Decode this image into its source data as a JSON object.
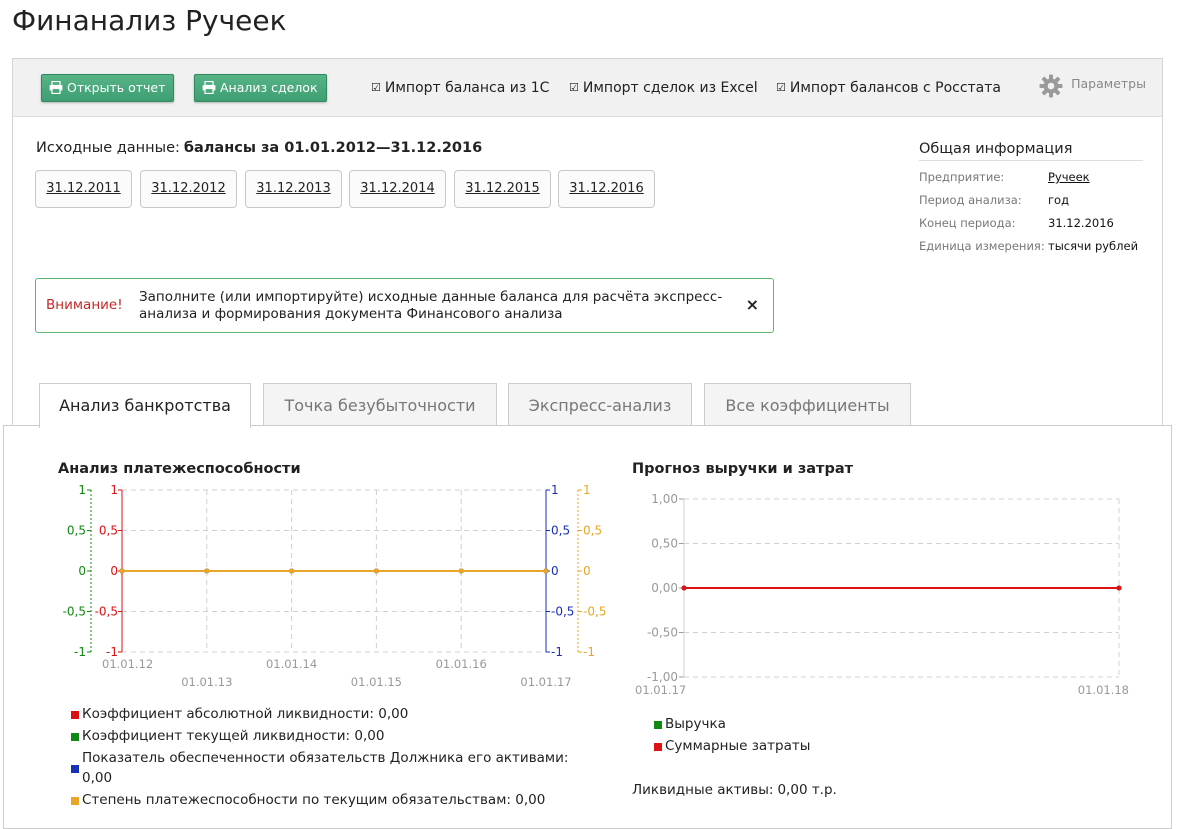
{
  "app": {
    "title": "Финанализ Ручеек"
  },
  "toolbar": {
    "open_report": "Открыть отчет",
    "deals_analysis": "Анализ сделок",
    "import_1c": "Импорт баланса из 1С",
    "import_excel": "Импорт сделок из Excel",
    "import_rosstat": "Импорт балансов с Росстата",
    "params": "Параметры"
  },
  "source": {
    "label": "Исходные данные:",
    "value": "балансы за 01.01.2012—31.12.2016"
  },
  "dates": [
    "31.12.2011",
    "31.12.2012",
    "31.12.2013",
    "31.12.2014",
    "31.12.2015",
    "31.12.2016"
  ],
  "info": {
    "title": "Общая информация",
    "rows": [
      {
        "key": "Предприятие:",
        "value": "Ручеек"
      },
      {
        "key": "Период анализа:",
        "value": "год"
      },
      {
        "key": "Конец периода:",
        "value": "31.12.2016"
      },
      {
        "key": "Единица измерения:",
        "value": "тысячи рублей"
      }
    ]
  },
  "alert": {
    "label": "Внимание!",
    "message": "Заполните (или импортируйте) исходные данные баланса для расчёта экспресс-анализа и формирования документа Финансового анализа",
    "close": "×"
  },
  "tabs": [
    "Анализ банкротства",
    "Точка безубыточности",
    "Экспресс-анализ",
    "Все коэффициенты"
  ],
  "colors": {
    "red": "#dd1111",
    "green": "#118811",
    "blue": "#1a2fb8",
    "orange": "#e8a628",
    "accent": "#4aa97a"
  },
  "chart_data": [
    {
      "type": "line",
      "title": "Анализ платежеспособности",
      "x": [
        "01.01.12",
        "01.01.13",
        "01.01.14",
        "01.01.15",
        "01.01.16",
        "01.01.17"
      ],
      "ylim": [
        -1,
        1
      ],
      "yticks": [
        "-1",
        "-0,5",
        "0",
        "0,5",
        "1"
      ],
      "grid": true,
      "series": [
        {
          "name": "Коэффициент абсолютной ликвидности: 0,00",
          "color": "#dd1111",
          "values": [
            0,
            0,
            0,
            0,
            0,
            0
          ]
        },
        {
          "name": "Коэффициент текущей ликвидности: 0,00",
          "color": "#118811",
          "values": [
            0,
            0,
            0,
            0,
            0,
            0
          ]
        },
        {
          "name": "Показатель обеспеченности обязательств Должника его активами: 0,00",
          "color": "#1a2fb8",
          "values": [
            0,
            0,
            0,
            0,
            0,
            0
          ]
        },
        {
          "name": "Степень платежеспособности по текущим обязательствам: 0,00",
          "color": "#e8a628",
          "values": [
            0,
            0,
            0,
            0,
            0,
            0
          ]
        }
      ]
    },
    {
      "type": "line",
      "title": "Прогноз выручки и затрат",
      "x": [
        "01.01.17",
        "01.01.18"
      ],
      "ylim": [
        -1,
        1
      ],
      "yticks": [
        "-1,00",
        "-0,50",
        "0,00",
        "0,50",
        "1,00"
      ],
      "grid": true,
      "series": [
        {
          "name": "Выручка",
          "color": "#118811",
          "values": [
            0,
            0
          ]
        },
        {
          "name": "Суммарные затраты",
          "color": "#dd1111",
          "values": [
            0,
            0
          ]
        }
      ]
    }
  ],
  "liquid_assets": {
    "label": "Ликвидные активы:",
    "value": "0,00 т.р."
  }
}
